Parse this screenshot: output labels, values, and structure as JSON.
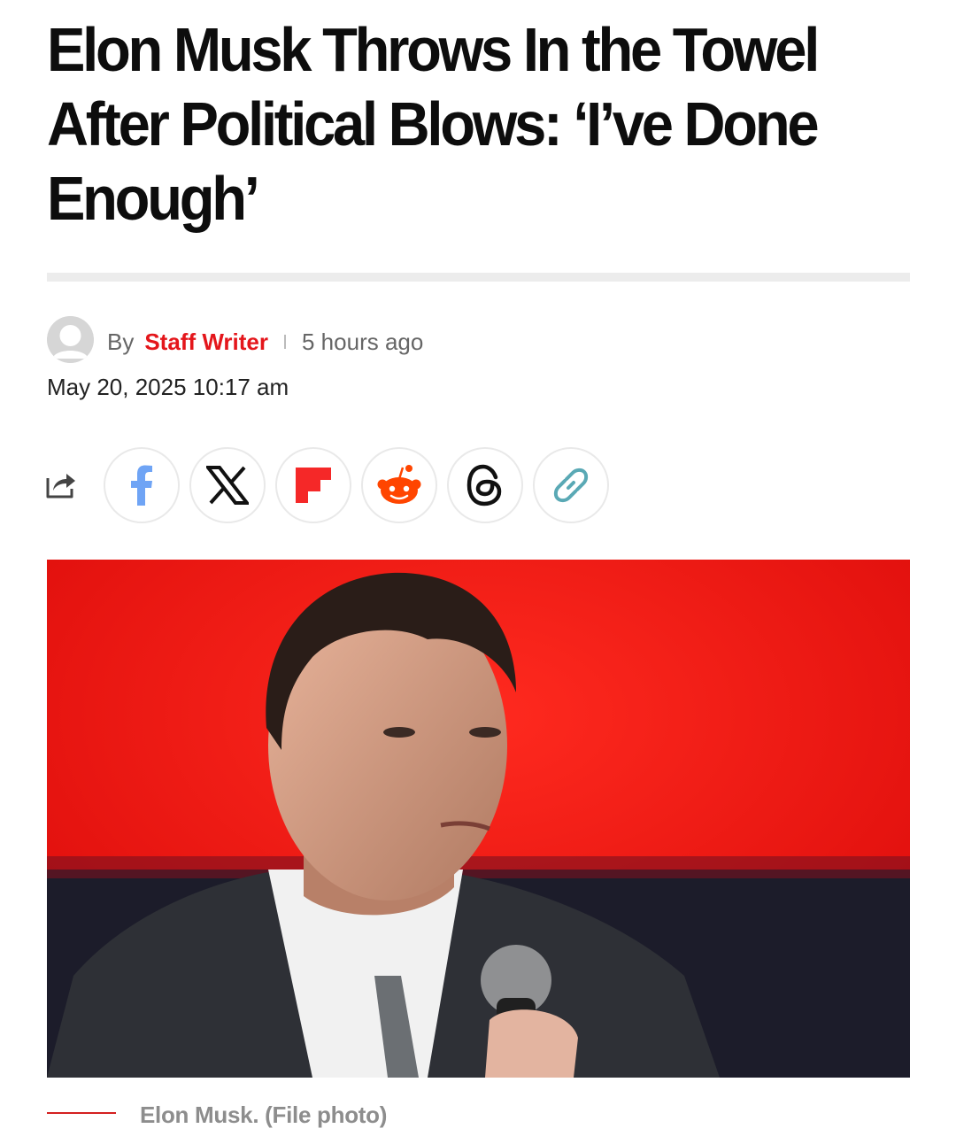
{
  "article": {
    "headline": "Elon Musk Throws In the Towel After Political Blows: ‘I’ve Done Enough’",
    "by_label": "By",
    "author": "Staff Writer",
    "time_ago": "5 hours ago",
    "date": "May 20, 2025 10:17 am"
  },
  "share": {
    "buttons": [
      {
        "name": "facebook",
        "icon": "facebook-icon"
      },
      {
        "name": "x",
        "icon": "x-icon"
      },
      {
        "name": "flipboard",
        "icon": "flipboard-icon"
      },
      {
        "name": "reddit",
        "icon": "reddit-icon"
      },
      {
        "name": "threads",
        "icon": "threads-icon"
      },
      {
        "name": "copy-link",
        "icon": "link-icon"
      }
    ]
  },
  "image": {
    "caption": "Elon Musk. (File photo)"
  },
  "colors": {
    "accent": "#e4161b",
    "facebook": "#1877f2",
    "reddit": "#ff4500",
    "link": "#5aa9b5"
  }
}
